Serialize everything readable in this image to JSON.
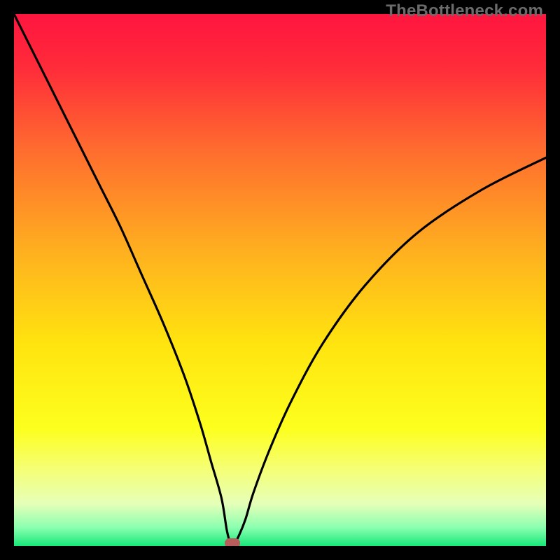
{
  "watermark": {
    "text": "TheBottleneck.com"
  },
  "colors": {
    "frame": "#000000",
    "gradient_stops": [
      {
        "offset": 0.0,
        "color": "#ff153f"
      },
      {
        "offset": 0.1,
        "color": "#ff2b3a"
      },
      {
        "offset": 0.25,
        "color": "#ff6a2f"
      },
      {
        "offset": 0.45,
        "color": "#ffb11f"
      },
      {
        "offset": 0.62,
        "color": "#ffe40f"
      },
      {
        "offset": 0.78,
        "color": "#fdff1e"
      },
      {
        "offset": 0.86,
        "color": "#f4ff7a"
      },
      {
        "offset": 0.92,
        "color": "#e6ffb8"
      },
      {
        "offset": 0.965,
        "color": "#8bffb0"
      },
      {
        "offset": 1.0,
        "color": "#17e87a"
      }
    ],
    "curve": "#000000",
    "marker": "#b85c5c"
  },
  "chart_data": {
    "type": "line",
    "title": "",
    "xlabel": "",
    "ylabel": "",
    "xlim": [
      0,
      100
    ],
    "ylim": [
      0,
      100
    ],
    "grid": false,
    "legend": false,
    "series": [
      {
        "name": "bottleneck-curve",
        "x": [
          0,
          4,
          8,
          12,
          16,
          20,
          24,
          28,
          32,
          35,
          37,
          39,
          40,
          40.7,
          41.4,
          42.2,
          43.5,
          45,
          48,
          52,
          58,
          66,
          76,
          88,
          100
        ],
        "y": [
          100,
          92,
          84,
          76,
          68,
          60,
          51,
          42,
          32,
          23,
          16,
          9,
          3,
          0.5,
          0.5,
          1.8,
          5,
          10,
          18,
          27,
          38,
          49,
          59,
          67,
          73
        ]
      }
    ],
    "marker": {
      "x": 41.0,
      "y": 0.5
    },
    "notes": "V-shaped bottleneck curve over a vertical bottleneck-severity color gradient (red=high, green=low). Minimum at roughly x=41 where the curve touches the green band; a small rounded marker sits at the minimum."
  }
}
